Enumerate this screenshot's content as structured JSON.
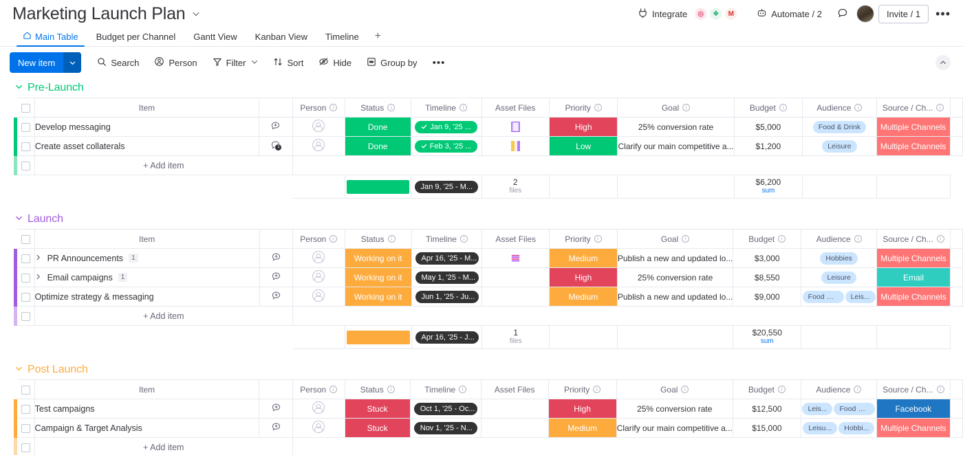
{
  "header": {
    "title": "Marketing Launch Plan",
    "title_caret": "chevron-down",
    "integrate_label": "Integrate",
    "integrate_apps": [
      "◎",
      "❖",
      "M"
    ],
    "automate_label": "Automate / 2",
    "invite_label": "Invite / 1",
    "more_label": "•••"
  },
  "tabs": [
    {
      "label": "Main Table",
      "icon": "home-icon",
      "active": true
    },
    {
      "label": "Budget per Channel",
      "active": false
    },
    {
      "label": "Gantt View",
      "active": false
    },
    {
      "label": "Kanban View",
      "active": false
    },
    {
      "label": "Timeline",
      "active": false
    }
  ],
  "tab_add": "+",
  "toolbar": {
    "new_item": "New item",
    "new_item_caret": "⌄",
    "buttons": [
      {
        "label": "Search",
        "icon": "search-icon"
      },
      {
        "label": "Person",
        "icon": "person-icon"
      },
      {
        "label": "Filter",
        "icon": "filter-icon",
        "caret": true
      },
      {
        "label": "Sort",
        "icon": "sort-icon"
      },
      {
        "label": "Hide",
        "icon": "hide-icon"
      },
      {
        "label": "Group by",
        "icon": "groupby-icon"
      }
    ],
    "more": "•••",
    "collapse": "⌃"
  },
  "columns": [
    {
      "label": "Item",
      "info": false
    },
    {
      "label": "Person",
      "info": true
    },
    {
      "label": "Status",
      "info": true
    },
    {
      "label": "Timeline",
      "info": true
    },
    {
      "label": "Asset Files",
      "info": false
    },
    {
      "label": "Priority",
      "info": true
    },
    {
      "label": "Goal",
      "info": true
    },
    {
      "label": "Budget",
      "info": true
    },
    {
      "label": "Audience",
      "info": true
    },
    {
      "label": "Source / Ch...",
      "info": true
    }
  ],
  "add_item_label": "+ Add item",
  "colors": {
    "green": "#00c875",
    "orange": "#fdab3d",
    "red": "#e2445c",
    "purple": "#a25ddc",
    "blue": "#0073ea",
    "salmon": "#ff7575",
    "teal": "#2ecdc0",
    "facebook_blue": "#1f76c2",
    "tag_blue": "#cce5ff",
    "dark_pill": "#333333"
  },
  "groups": [
    {
      "name": "Pre-Launch",
      "color": "#00c875",
      "status_accent": "#00c875",
      "priority_accent": "#e2445c",
      "source_accent": "#ff7575",
      "rows": [
        {
          "item": "Develop messaging",
          "expandable": false,
          "sub_count": null,
          "chat_badge": null,
          "status": "Done",
          "status_color": "#00c875",
          "timeline": "Jan 9, '25 ...",
          "timeline_style": "green-check",
          "asset_file": "file-thumb-purple",
          "priority": "High",
          "priority_color": "#e2445c",
          "goal": "25% conversion rate",
          "budget": "$5,000",
          "audience": [
            "Food & Drink"
          ],
          "source": "Multiple Channels",
          "source_color": "#ff7575"
        },
        {
          "item": "Create asset collaterals",
          "expandable": false,
          "sub_count": null,
          "chat_badge": "1",
          "status": "Done",
          "status_color": "#00c875",
          "timeline": "Feb 3, '25 ...",
          "timeline_style": "green-check",
          "asset_file": "file-thumb-yellow",
          "priority": "Low",
          "priority_color": "#00c875",
          "goal": "Clarify our main competitive a...",
          "budget": "$1,200",
          "audience": [
            "Leisure"
          ],
          "source": "Multiple Channels",
          "source_color": "#ff7575"
        }
      ],
      "summary": {
        "status_bar_color": "#00c875",
        "timeline": "Jan 9, '25 - M...",
        "files_count": "2",
        "files_label": "files",
        "budget_sum": "$6,200",
        "budget_label": "sum"
      }
    },
    {
      "name": "Launch",
      "color": "#a25ddc",
      "status_accent": "#fdab3d",
      "priority_accent": "#fdab3d",
      "source_accent": "#ff7575",
      "rows": [
        {
          "item": "PR Announcements",
          "expandable": true,
          "sub_count": "1",
          "chat_badge": null,
          "status": "Working on it",
          "status_color": "#fdab3d",
          "timeline": "Apr 16, '25 - M...",
          "timeline_style": "dark",
          "asset_file": "file-thumb-pink",
          "priority": "Medium",
          "priority_color": "#fdab3d",
          "goal": "Publish a new and updated lo...",
          "budget": "$3,000",
          "audience": [
            "Hobbies"
          ],
          "source": "Multiple Channels",
          "source_color": "#ff7575"
        },
        {
          "item": "Email campaigns",
          "expandable": true,
          "sub_count": "1",
          "chat_badge": null,
          "status": "Working on it",
          "status_color": "#fdab3d",
          "timeline": "May 1, '25 - M...",
          "timeline_style": "dark",
          "asset_file": null,
          "priority": "High",
          "priority_color": "#e2445c",
          "goal": "25% conversion rate",
          "budget": "$8,550",
          "audience": [
            "Leisure"
          ],
          "source": "Email",
          "source_color": "#2ecdc0"
        },
        {
          "item": "Optimize strategy & messaging",
          "expandable": false,
          "sub_count": null,
          "chat_badge": null,
          "status": "Working on it",
          "status_color": "#fdab3d",
          "timeline": "Jun 1, '25 - Ju...",
          "timeline_style": "dark",
          "asset_file": null,
          "priority": "Medium",
          "priority_color": "#fdab3d",
          "goal": "Publish a new and updated lo...",
          "budget": "$9,000",
          "audience": [
            "Food & ...",
            "Leis..."
          ],
          "source": "Multiple Channels",
          "source_color": "#ff7575"
        }
      ],
      "summary": {
        "status_bar_color": "#fdab3d",
        "timeline": "Apr 16, '25 - J...",
        "files_count": "1",
        "files_label": "files",
        "budget_sum": "$20,550",
        "budget_label": "sum"
      }
    },
    {
      "name": "Post Launch",
      "color": "#fdab3d",
      "status_accent": "#e2445c",
      "priority_accent": "#e2445c",
      "source_accent": "#1f76c2",
      "rows": [
        {
          "item": "Test campaigns",
          "expandable": false,
          "sub_count": null,
          "chat_badge": null,
          "status": "Stuck",
          "status_color": "#e2445c",
          "timeline": "Oct 1, '25 - Oc...",
          "timeline_style": "dark",
          "asset_file": null,
          "priority": "High",
          "priority_color": "#e2445c",
          "goal": "25% conversion rate",
          "budget": "$12,500",
          "audience": [
            "Leis...",
            "Food & ..."
          ],
          "source": "Facebook",
          "source_color": "#1f76c2"
        },
        {
          "item": "Campaign & Target Analysis",
          "expandable": false,
          "sub_count": null,
          "chat_badge": null,
          "status": "Stuck",
          "status_color": "#e2445c",
          "timeline": "Nov 1, '25 - N...",
          "timeline_style": "dark",
          "asset_file": null,
          "priority": "Medium",
          "priority_color": "#fdab3d",
          "goal": "Clarify our main competitive a...",
          "budget": "$15,000",
          "audience": [
            "Leisu...",
            "Hobbi..."
          ],
          "source": "Multiple Channels",
          "source_color": "#ff7575"
        }
      ],
      "summary": null
    }
  ]
}
